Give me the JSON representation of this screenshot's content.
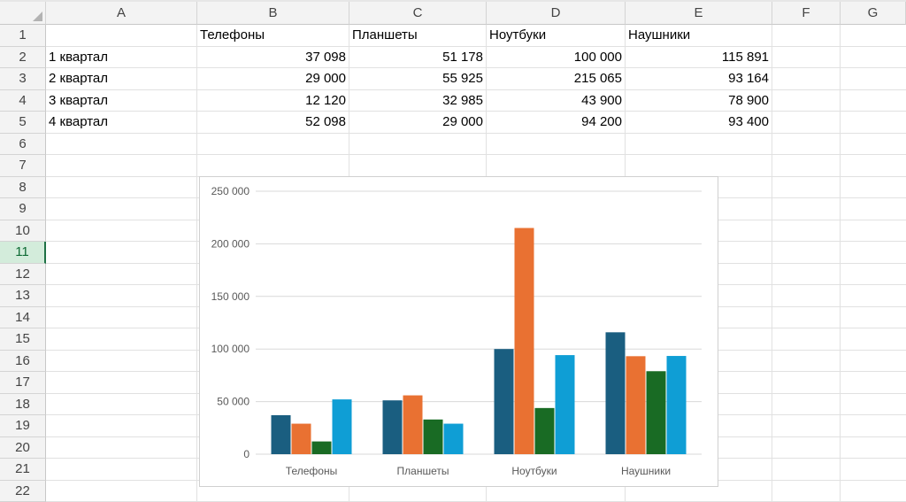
{
  "columns": [
    "A",
    "B",
    "C",
    "D",
    "E",
    "F",
    "G"
  ],
  "rows": [
    "1",
    "2",
    "3",
    "4",
    "5",
    "6",
    "7",
    "8",
    "9",
    "10",
    "11",
    "12",
    "13",
    "14",
    "15",
    "16",
    "17",
    "18",
    "19",
    "20",
    "21",
    "22"
  ],
  "selected_row": "11",
  "table": {
    "headers": [
      "Телефоны",
      "Планшеты",
      "Ноутбуки",
      "Наушники"
    ],
    "data": [
      {
        "label": "1 квартал",
        "values": [
          "37 098",
          "51 178",
          "100 000",
          "115 891"
        ]
      },
      {
        "label": "2 квартал",
        "values": [
          "29 000",
          "55 925",
          "215 065",
          "93 164"
        ]
      },
      {
        "label": "3 квартал",
        "values": [
          "12 120",
          "32 985",
          "43 900",
          "78 900"
        ]
      },
      {
        "label": "4 квартал",
        "values": [
          "52 098",
          "29 000",
          "94 200",
          "93 400"
        ]
      }
    ]
  },
  "colors": {
    "series": [
      "#1a5e80",
      "#e97132",
      "#196b24",
      "#0f9ed5"
    ],
    "grid": "#d9d9d9",
    "selected_row_bg": "#d3ecdb"
  },
  "chart_data": {
    "type": "bar",
    "categories": [
      "Телефоны",
      "Планшеты",
      "Ноутбуки",
      "Наушники"
    ],
    "series": [
      {
        "values": [
          37098,
          51178,
          100000,
          115891
        ]
      },
      {
        "values": [
          29000,
          55925,
          215065,
          93164
        ]
      },
      {
        "values": [
          12120,
          32985,
          43900,
          78900
        ]
      },
      {
        "values": [
          52098,
          29000,
          94200,
          93400
        ]
      }
    ],
    "ylim": [
      0,
      250000
    ],
    "yticks": [
      0,
      50000,
      100000,
      150000,
      200000,
      250000
    ],
    "ytick_labels": [
      "0",
      "50 000",
      "100 000",
      "150 000",
      "200 000",
      "250 000"
    ],
    "grid": true,
    "title": "",
    "xlabel": "",
    "ylabel": ""
  }
}
